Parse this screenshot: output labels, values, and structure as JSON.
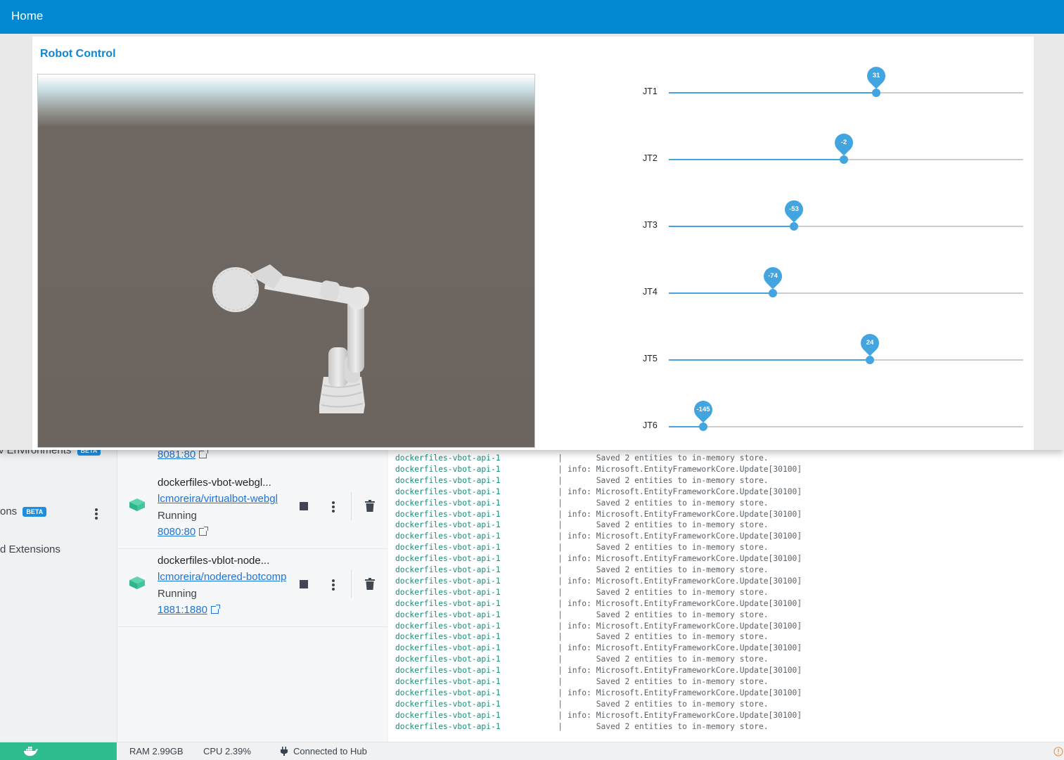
{
  "app": {
    "nav_title": "Home",
    "panel_title": "Robot Control",
    "sliders": [
      {
        "label": "JT1",
        "value": 31,
        "display": "31"
      },
      {
        "label": "JT2",
        "value": -2,
        "display": "-2"
      },
      {
        "label": "JT3",
        "value": -53,
        "display": "-53"
      },
      {
        "label": "JT4",
        "value": -74,
        "display": "-74"
      },
      {
        "label": "JT5",
        "value": 24,
        "display": "24"
      },
      {
        "label": "JT6",
        "value": -145,
        "display": "-145"
      }
    ],
    "accent_color": "#42a5e0",
    "header_color": "#0288d1"
  },
  "docker": {
    "sidebar": {
      "environments_label": "v Environments",
      "environments_badge": "BETA",
      "extensions_label": "ons",
      "extensions_badge": "BETA",
      "add_extensions_label": "d Extensions"
    },
    "top_port": "8081:80",
    "containers": [
      {
        "name": "dockerfiles-vbot-webgl...",
        "image": "lcmoreira/virtualbot-webgl",
        "status": "Running",
        "port": "8080:80"
      },
      {
        "name": "dockerfiles-vblot-node...",
        "image": "lcmoreira/nodered-botcomp",
        "status": "Running",
        "port": "1881:1880"
      }
    ],
    "logs": {
      "service": "dockerfiles-vbot-api-1",
      "separator": "|",
      "lines": [
        "      Saved 2 entities to in-memory store.",
        "info: Microsoft.EntityFrameworkCore.Update[30100]",
        "      Saved 2 entities to in-memory store.",
        "info: Microsoft.EntityFrameworkCore.Update[30100]",
        "      Saved 2 entities to in-memory store.",
        "info: Microsoft.EntityFrameworkCore.Update[30100]",
        "      Saved 2 entities to in-memory store.",
        "info: Microsoft.EntityFrameworkCore.Update[30100]",
        "      Saved 2 entities to in-memory store.",
        "info: Microsoft.EntityFrameworkCore.Update[30100]",
        "      Saved 2 entities to in-memory store.",
        "info: Microsoft.EntityFrameworkCore.Update[30100]",
        "      Saved 2 entities to in-memory store.",
        "info: Microsoft.EntityFrameworkCore.Update[30100]",
        "      Saved 2 entities to in-memory store.",
        "info: Microsoft.EntityFrameworkCore.Update[30100]",
        "      Saved 2 entities to in-memory store.",
        "info: Microsoft.EntityFrameworkCore.Update[30100]",
        "      Saved 2 entities to in-memory store.",
        "info: Microsoft.EntityFrameworkCore.Update[30100]",
        "      Saved 2 entities to in-memory store.",
        "info: Microsoft.EntityFrameworkCore.Update[30100]",
        "      Saved 2 entities to in-memory store.",
        "info: Microsoft.EntityFrameworkCore.Update[30100]",
        "      Saved 2 entities to in-memory store."
      ]
    },
    "status_bar": {
      "ram": "RAM 2.99GB",
      "cpu": "CPU 2.39%",
      "hub": "Connected to Hub"
    },
    "icons": {
      "whale": "docker-whale-icon",
      "plug": "plug-icon",
      "container": "container-cube-icon",
      "stop": "stop-icon",
      "menu": "kebab-menu-icon",
      "delete": "trash-icon",
      "external": "external-link-icon"
    }
  }
}
